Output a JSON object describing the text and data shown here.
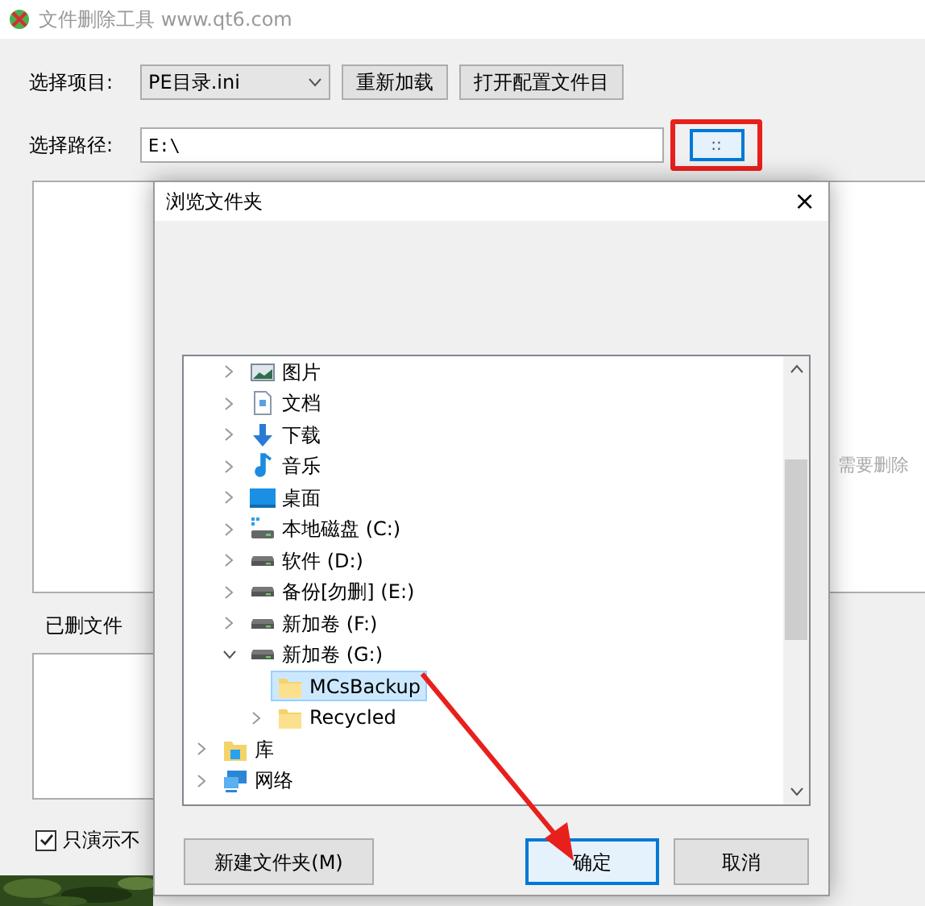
{
  "window": {
    "title": "文件删除工具 www.qt6.com"
  },
  "project": {
    "label": "选择项目:",
    "value": "PE目录.ini"
  },
  "buttons": [
    "重新加载",
    "打开配置文件目"
  ],
  "path": {
    "label": "选择路径:",
    "value": "E:\\",
    "browse": "::"
  },
  "deleted": {
    "label": "已删文件"
  },
  "right_label": "需要删除",
  "demo_option": {
    "label": "只演示不",
    "checked": true
  },
  "dialog": {
    "title": "浏览文件夹",
    "close": "×",
    "tree": [
      {
        "children": [
          {
            "label": "图片",
            "kind": "pictures",
            "expanded": false,
            "selected": false
          },
          {
            "label": "文档",
            "kind": "documents",
            "expanded": false,
            "selected": false
          },
          {
            "label": "下载",
            "kind": "download",
            "expanded": false,
            "selected": false
          },
          {
            "label": "音乐",
            "kind": "music",
            "expanded": false,
            "selected": false
          },
          {
            "label": "桌面",
            "kind": "desktop",
            "expanded": false,
            "selected": false
          },
          {
            "label": "本地磁盘 (C:)",
            "kind": "system-drive",
            "expanded": false,
            "selected": false
          },
          {
            "label": "软件 (D:)",
            "kind": "drive",
            "expanded": false,
            "selected": false
          },
          {
            "label": "备份[勿删] (E:)",
            "kind": "drive",
            "expanded": false,
            "selected": false
          },
          {
            "label": "新加卷 (F:)",
            "kind": "drive",
            "expanded": false,
            "selected": false
          },
          {
            "label": "新加卷 (G:)",
            "kind": "drive",
            "expanded": true,
            "selected": false,
            "children": [
              {
                "label": "MCsBackup",
                "kind": "folder",
                "selected": true
              },
              {
                "label": "Recycled",
                "kind": "folder",
                "expanded": false,
                "selected": false
              }
            ]
          }
        ]
      },
      {
        "label": "库",
        "kind": "library",
        "expanded": false,
        "selected": false
      },
      {
        "label": "网络",
        "kind": "network",
        "expanded": false,
        "selected": false
      }
    ],
    "buttons": [
      {
        "label": "新建文件夹(M)",
        "focused": false
      },
      {
        "label": "确定",
        "focused": true
      },
      {
        "label": "取消",
        "focused": false
      }
    ]
  }
}
